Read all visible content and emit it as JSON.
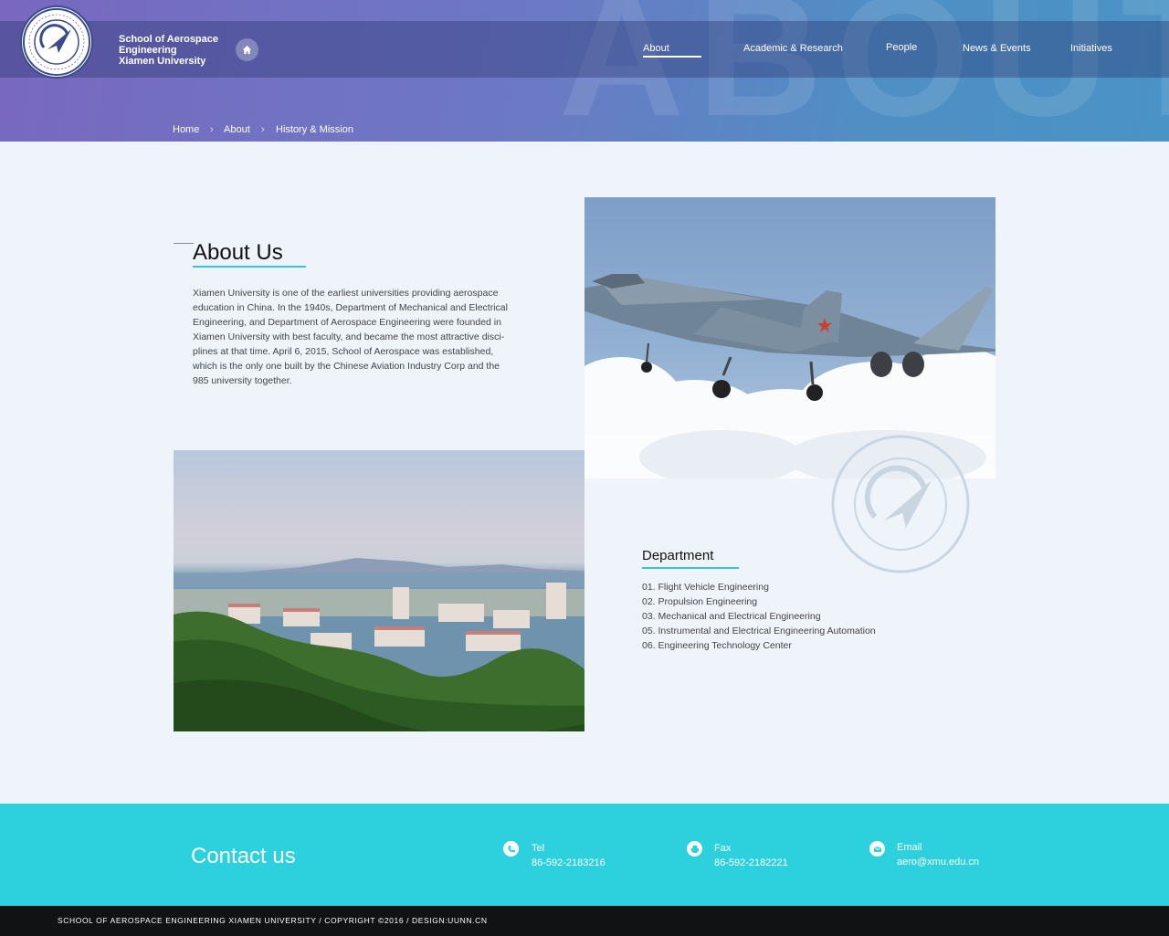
{
  "header": {
    "background_word": "ABOUT",
    "school_name_line1": "School of Aerospace",
    "school_name_line2": "Engineering",
    "school_name_line3": "Xiamen University",
    "home_icon": "home-icon",
    "nav": [
      {
        "label": "About",
        "active": true
      },
      {
        "label": "Academic & Research"
      },
      {
        "label": "People"
      },
      {
        "label": "News & Events"
      },
      {
        "label": "Initiatives"
      }
    ]
  },
  "breadcrumb": [
    "Home",
    "About",
    "History & Mission"
  ],
  "about": {
    "title": "About Us",
    "lines": [
      "Xiamen University is one of the earliest universities providing aerospace",
      "education in China. In the 1940s, Department of Mechanical and Electrical",
      "Engineering, and Department of Aerospace Engineering were founded in",
      "Xiamen University with best faculty, and became the most attractive disci-",
      "plines at that time. April 6, 2015, School of Aerospace was established,",
      "which is the only one built by the Chinese Aviation Industry Corp and the",
      "985 university together."
    ]
  },
  "department": {
    "title": "Department",
    "items": [
      "01. Flight Vehicle Engineering",
      "02. Propulsion Engineering",
      "03. Mechanical and Electrical Engineering",
      "05. Instrumental and Electrical Engineering Automation",
      "06. Engineering Technology Center"
    ]
  },
  "contact": {
    "title": "Contact us",
    "tel_label": "Tel",
    "tel_value": "86-592-2183216",
    "fax_label": "Fax",
    "fax_value": "86-592-2182221",
    "email_label": "Email",
    "email_value": "aero@xmu.edu.cn"
  },
  "footer": {
    "text": "SCHOOL OF AEROSPACE ENGINEERING XIAMEN UNIVERSITY   /  COPYRIGHT ©2016   /  DESIGN:UUNN.CN"
  },
  "colors": {
    "accent": "#2dd0dd",
    "header_start": "#7868bf",
    "header_end": "#4a93c6",
    "footer_bg": "#101214"
  }
}
